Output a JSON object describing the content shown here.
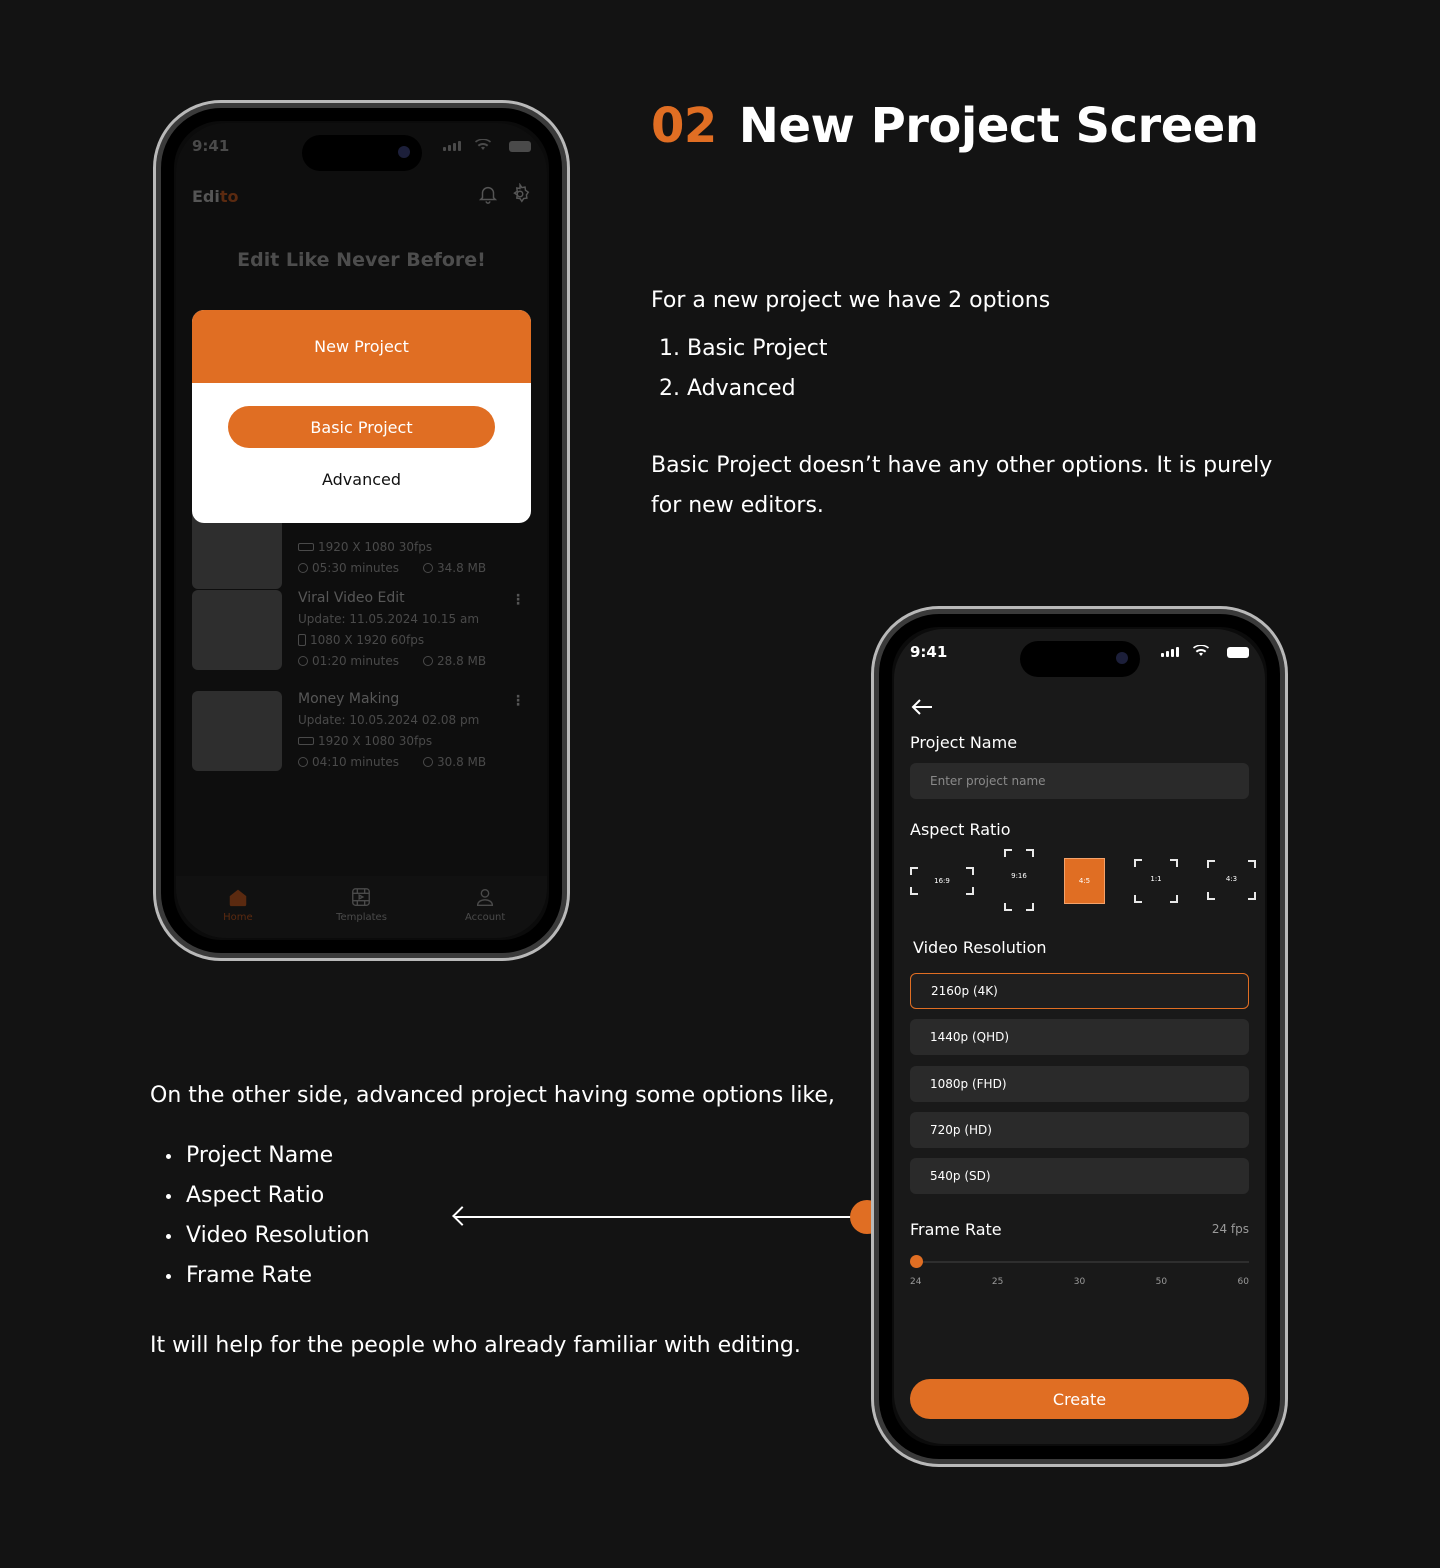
{
  "heading": {
    "number": "02",
    "title": "New Project Screen"
  },
  "intro": {
    "lead": "For a new project we have 2 options",
    "options": [
      "1. Basic Project",
      "2. Advanced"
    ],
    "basic_note_1": "Basic Project doesn’t have any other options. It is purely",
    "basic_note_2": "for new editors."
  },
  "advanced_info": {
    "lead": "On the other side, advanced project having some options like,",
    "bullets": [
      "Project Name",
      "Aspect  Ratio",
      "Video Resolution",
      "Frame Rate"
    ],
    "closing": "It will help for the people who already familiar with editing."
  },
  "colors": {
    "accent": "#e06e23",
    "background": "#131313",
    "surface": "#2a2a2a"
  },
  "phone1": {
    "status_time": "9:41",
    "brand_prefix": "Edi",
    "brand_suffix": "to",
    "icons": [
      "bell-icon",
      "settings-icon"
    ],
    "banner": "Edit Like Never Before!",
    "modal": {
      "title": "New Project",
      "basic": "Basic Project",
      "advanced": "Advanced"
    },
    "projects": [
      {
        "title": "",
        "updated": "",
        "resolution": "1920 X 1080  30fps",
        "duration": "05:30 minutes",
        "size": "34.8 MB"
      },
      {
        "title": "Viral Video Edit",
        "updated": "Update: 11.05.2024  10.15 am",
        "resolution": "1080 X 1920  60fps",
        "duration": "01:20 minutes",
        "size": "28.8 MB"
      },
      {
        "title": "Money Making",
        "updated": "Update: 10.05.2024  02.08 pm",
        "resolution": "1920 X 1080  30fps",
        "duration": "04:10 minutes",
        "size": "30.8 MB"
      }
    ],
    "tabs": [
      {
        "label": "Home",
        "icon": "home-icon",
        "active": true
      },
      {
        "label": "Templates",
        "icon": "film-icon",
        "active": false
      },
      {
        "label": "Account",
        "icon": "user-icon",
        "active": false
      }
    ]
  },
  "phone2": {
    "status_time": "9:41",
    "project_name_label": "Project Name",
    "project_name_placeholder": "Enter project name",
    "aspect_ratio_label": "Aspect Ratio",
    "aspect_ratios": [
      "16:9",
      "9:16",
      "4:5",
      "1:1",
      "4:3"
    ],
    "aspect_ratio_selected": "4:5",
    "video_resolution_label": "Video Resolution",
    "resolutions": [
      "2160p (4K)",
      "1440p (QHD)",
      "1080p (FHD)",
      "720p (HD)",
      "540p (SD)"
    ],
    "resolution_selected": "2160p (4K)",
    "frame_rate_label": "Frame Rate",
    "frame_rate_value": "24 fps",
    "frame_rate_ticks": [
      "24",
      "25",
      "30",
      "50",
      "60"
    ],
    "create_label": "Create"
  }
}
